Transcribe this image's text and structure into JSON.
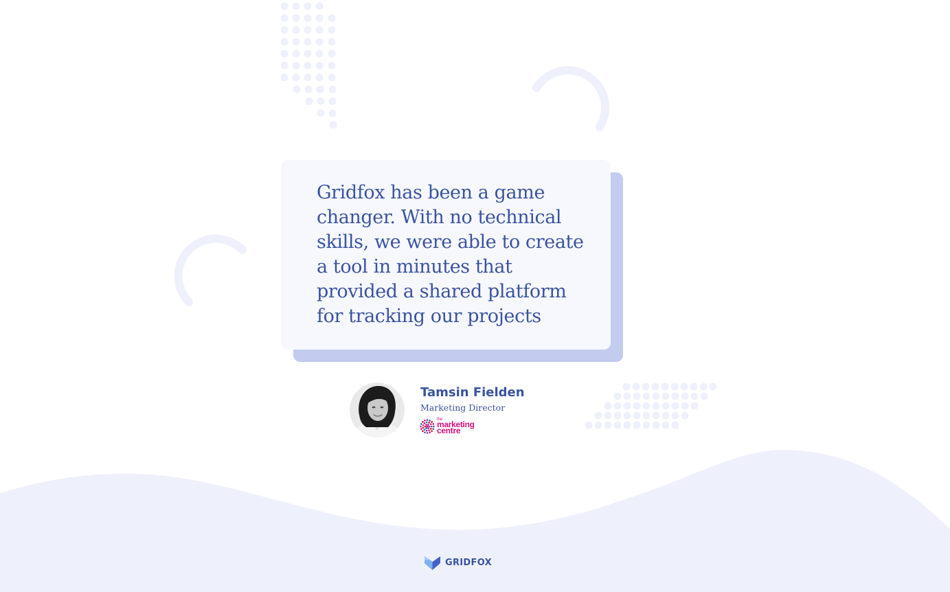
{
  "testimonial": {
    "quote": "Gridfox has been a game changer. With no technical skills, we were able to create a tool in minutes that provided a shared platform for tracking our projects",
    "author_name": "Tamsin Fielden",
    "author_role": "Marketing Director",
    "company": {
      "small_text": "the",
      "line1": "marketing",
      "line2": "centre"
    }
  },
  "footer": {
    "brand_name": "GRIDFOX"
  },
  "colors": {
    "text_primary": "#3a539f",
    "card_bg": "#f7f8fd",
    "card_shadow": "#c3ccef",
    "wave": "#eef1fc",
    "decor": "#eef0fb",
    "company_accent": "#d4117e",
    "brand_icon_light": "#7fb0f0",
    "brand_icon_dark": "#4460c8"
  },
  "icons": {
    "avatar": "person-portrait",
    "company_mark": "dotted-flower-icon",
    "brand_mark": "fox-icon"
  }
}
